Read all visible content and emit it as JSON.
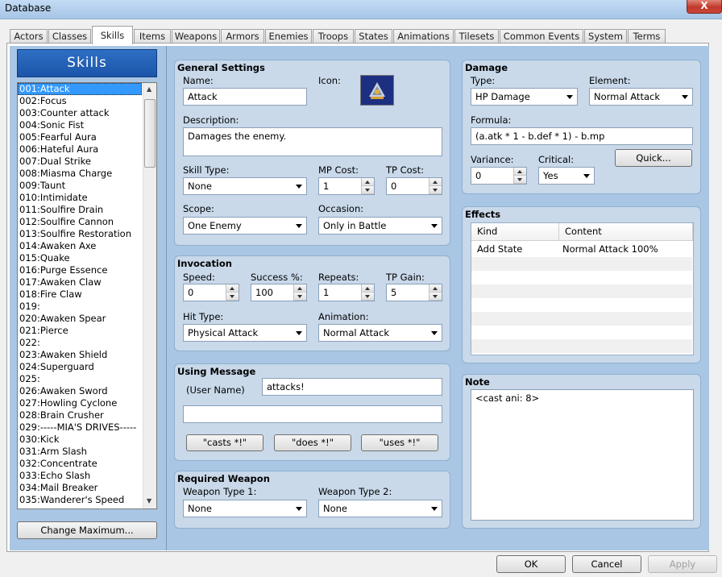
{
  "window": {
    "title": "Database",
    "close_label": "X"
  },
  "tabs": [
    "Actors",
    "Classes",
    "Skills",
    "Items",
    "Weapons",
    "Armors",
    "Enemies",
    "Troops",
    "States",
    "Animations",
    "Tilesets",
    "Common Events",
    "System",
    "Terms"
  ],
  "active_tab": "Skills",
  "skills_panel": {
    "header": "Skills",
    "change_max_label": "Change Maximum...",
    "items": [
      "001:Attack",
      "002:Focus",
      "003:Counter attack",
      "004:Sonic Fist",
      "005:Fearful Aura",
      "006:Hateful Aura",
      "007:Dual Strike",
      "008:Miasma Charge",
      "009:Taunt",
      "010:Intimidate",
      "011:Soulfire Drain",
      "012:Soulfire Cannon",
      "013:Soulfire Restoration",
      "014:Awaken Axe",
      "015:Quake",
      "016:Purge Essence",
      "017:Awaken Claw",
      "018:Fire Claw",
      "019:",
      "020:Awaken Spear",
      "021:Pierce",
      "022:",
      "023:Awaken Shield",
      "024:Superguard",
      "025:",
      "026:Awaken Sword",
      "027:Howling Cyclone",
      "028:Brain Crusher",
      "029:-----MIA'S DRIVES-----",
      "030:Kick",
      "031:Arm Slash",
      "032:Concentrate",
      "033:Echo Slash",
      "034:Mail Breaker",
      "035:Wanderer's Speed"
    ]
  },
  "general": {
    "title": "General Settings",
    "name_label": "Name:",
    "name": "Attack",
    "icon_label": "Icon:",
    "desc_label": "Description:",
    "description": "Damages the enemy.",
    "skill_type_label": "Skill Type:",
    "skill_type": "None",
    "mp_label": "MP Cost:",
    "mp": "1",
    "tp_label": "TP Cost:",
    "tp": "0",
    "scope_label": "Scope:",
    "scope": "One Enemy",
    "occasion_label": "Occasion:",
    "occasion": "Only in Battle"
  },
  "invocation": {
    "title": "Invocation",
    "speed_label": "Speed:",
    "speed": "0",
    "success_label": "Success %:",
    "success": "100",
    "repeats_label": "Repeats:",
    "repeats": "1",
    "tpgain_label": "TP Gain:",
    "tpgain": "5",
    "hit_label": "Hit Type:",
    "hit": "Physical Attack",
    "anim_label": "Animation:",
    "anim": "Normal Attack"
  },
  "message": {
    "title": "Using Message",
    "user_label": "(User Name)",
    "line1": "attacks!",
    "line2": "",
    "b1": "\"casts *!\"",
    "b2": "\"does *!\"",
    "b3": "\"uses *!\""
  },
  "weapon": {
    "title": "Required Weapon",
    "w1_label": "Weapon Type 1:",
    "w1": "None",
    "w2_label": "Weapon Type 2:",
    "w2": "None"
  },
  "damage": {
    "title": "Damage",
    "type_label": "Type:",
    "type": "HP Damage",
    "elem_label": "Element:",
    "elem": "Normal Attack",
    "formula_label": "Formula:",
    "formula": "(a.atk * 1 - b.def * 1)  - b.mp",
    "var_label": "Variance:",
    "variance": "0",
    "crit_label": "Critical:",
    "crit": "Yes",
    "quick": "Quick..."
  },
  "effects": {
    "title": "Effects",
    "col_kind": "Kind",
    "col_content": "Content",
    "rows": [
      {
        "kind": "Add State",
        "content": "Normal Attack 100%"
      }
    ]
  },
  "note": {
    "title": "Note",
    "text": "<cast ani: 8>"
  },
  "footer": {
    "ok": "OK",
    "cancel": "Cancel",
    "apply": "Apply"
  }
}
